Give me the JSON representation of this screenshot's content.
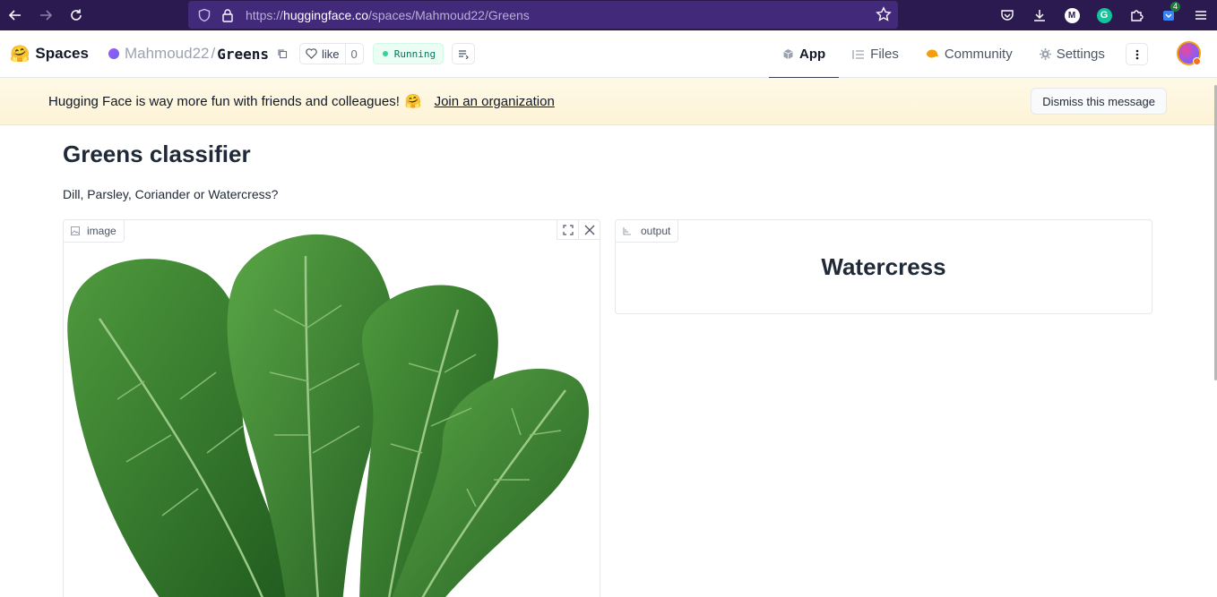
{
  "browser": {
    "url_prefix": "https://",
    "url_host": "huggingface.co",
    "url_path": "/spaces/Mahmoud22/Greens",
    "extension_badge": "4",
    "avatar_m": "M",
    "avatar_g": "G"
  },
  "header": {
    "brand_emoji": "🤗",
    "brand": "Spaces",
    "owner": "Mahmoud22",
    "separator": "/",
    "repo": "Greens",
    "like_label": "like",
    "like_count": "0",
    "status": "Running",
    "tabs": [
      {
        "label": "App",
        "icon": "cube-icon"
      },
      {
        "label": "Files",
        "icon": "files-icon"
      },
      {
        "label": "Community",
        "icon": "community-icon"
      },
      {
        "label": "Settings",
        "icon": "gear-icon"
      }
    ]
  },
  "banner": {
    "message": "Hugging Face is way more fun with friends and colleagues!",
    "emoji": "🤗",
    "link": "Join an organization",
    "dismiss": "Dismiss this message"
  },
  "app": {
    "title": "Greens classifier",
    "description": "Dill, Parsley, Coriander or Watercress?",
    "image_label": "image",
    "output_label": "output",
    "output_value": "Watercress"
  },
  "colors": {
    "browser_bg": "#2b1a4f",
    "urlbar_bg": "#42297a",
    "banner_bg": "#fdf3d6",
    "status_green": "#34d399"
  }
}
